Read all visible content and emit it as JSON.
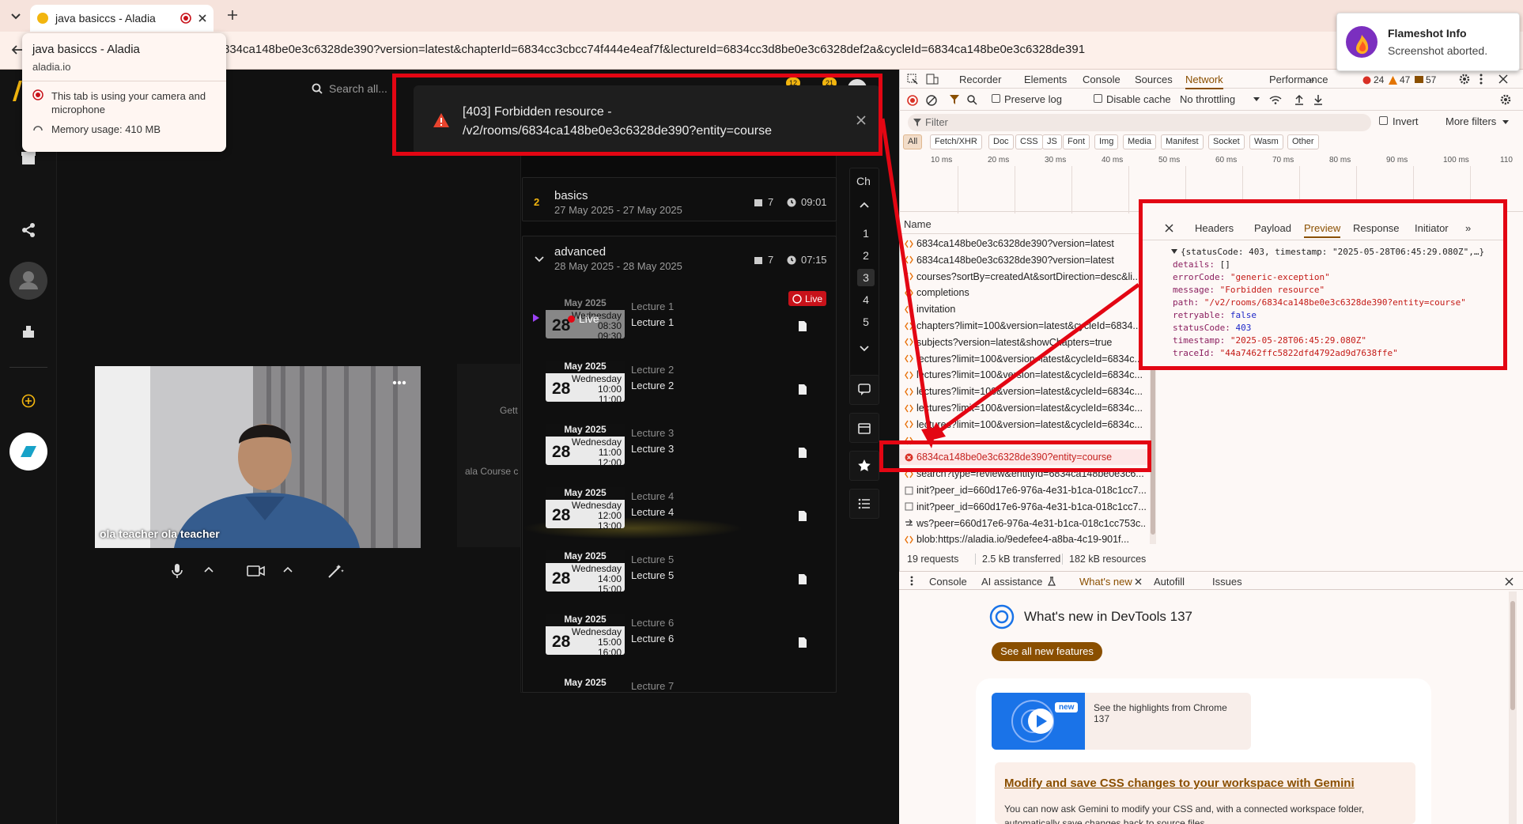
{
  "browser": {
    "tab_title": "java basiccs - Aladia",
    "url": "834ca148be0e3c6328de390?version=latest&chapterId=6834cc3cbcc74f444e4eaf7f&lectureId=6834cc3d8be0e3c6328def2a&cycleId=6834ca148be0e3c6328de391",
    "tab_popup": {
      "title": "java basiccs - Aladia",
      "domain": "aladia.io",
      "camera_note": "This tab is using your camera and microphone",
      "memory": "Memory usage: 410 MB"
    }
  },
  "flameshot": {
    "title": "Flameshot Info",
    "message": "Screenshot aborted."
  },
  "app": {
    "search_placeholder": "Search all...",
    "toast": {
      "line1": "[403] Forbidden resource -",
      "line2": "/v2/rooms/6834ca148be0e3c6328de390?entity=course"
    },
    "ch_label": "Ch",
    "chapters": [
      {
        "number": "2",
        "name": "basics",
        "dates": "27 May 2025 - 27 May 2025",
        "count": "7",
        "time": "09:01"
      },
      {
        "number": "",
        "name": "advanced",
        "dates": "28 May 2025 - 28 May 2025",
        "count": "7",
        "time": "07:15"
      }
    ],
    "live_badge": "Live",
    "live_overlay": "Live",
    "lectures": [
      {
        "month": "May 2025",
        "day": "28",
        "weekday": "Wednesday",
        "start": "08:30",
        "end": "09:30",
        "label": "Lecture 1",
        "name": "Lecture 1"
      },
      {
        "month": "May 2025",
        "day": "28",
        "weekday": "Wednesday",
        "start": "10:00",
        "end": "11:00",
        "label": "Lecture 2",
        "name": "Lecture 2"
      },
      {
        "month": "May 2025",
        "day": "28",
        "weekday": "Wednesday",
        "start": "11:00",
        "end": "12:00",
        "label": "Lecture 3",
        "name": "Lecture 3"
      },
      {
        "month": "May 2025",
        "day": "28",
        "weekday": "Wednesday",
        "start": "12:00",
        "end": "13:00",
        "label": "Lecture 4",
        "name": "Lecture 4"
      },
      {
        "month": "May 2025",
        "day": "28",
        "weekday": "Wednesday",
        "start": "14:00",
        "end": "15:00",
        "label": "Lecture 5",
        "name": "Lecture 5"
      },
      {
        "month": "May 2025",
        "day": "28",
        "weekday": "Wednesday",
        "start": "15:00",
        "end": "16:00",
        "label": "Lecture 6",
        "name": "Lecture 6"
      },
      {
        "month": "May 2025",
        "day": "",
        "weekday": "",
        "start": "",
        "end": "",
        "label": "Lecture 7",
        "name": ""
      }
    ],
    "chapter_numbers": [
      "1",
      "2",
      "3",
      "4",
      "5"
    ],
    "video_name": "ola teacher ola teacher",
    "bg_text1": "Gett",
    "bg_text2": "ala Course c",
    "header_badges": [
      "12",
      "21"
    ]
  },
  "devtools": {
    "tabs": [
      "Recorder",
      "Elements",
      "Console",
      "Sources",
      "Network",
      "Performance",
      "»"
    ],
    "active_tab": "Network",
    "errors": "24",
    "warnings": "47",
    "messages": "57",
    "preserve_log": "Preserve log",
    "disable_cache": "Disable cache",
    "throttling": "No throttling",
    "filter_placeholder": "Filter",
    "invert": "Invert",
    "more_filters": "More filters",
    "type_chips": [
      "All",
      "Fetch/XHR",
      "Doc",
      "CSS",
      "JS",
      "Font",
      "Img",
      "Media",
      "Manifest",
      "Socket",
      "Wasm",
      "Other"
    ],
    "timeline_labels": [
      "10 ms",
      "20 ms",
      "30 ms",
      "40 ms",
      "50 ms",
      "60 ms",
      "70 ms",
      "80 ms",
      "90 ms",
      "100 ms",
      "110"
    ],
    "name_header": "Name",
    "requests": [
      "6834ca148be0e3c6328de390?version=latest",
      "6834ca148be0e3c6328de390?version=latest",
      "courses?sortBy=createdAt&sortDirection=desc&li...",
      "completions",
      "invitation",
      "chapters?limit=100&version=latest&cycleId=6834...",
      "subjects?version=latest&showChapters=true",
      "lectures?limit=100&version=latest&cycleId=6834c...",
      "lectures?limit=100&version=latest&cycleId=6834c...",
      "lectures?limit=100&version=latest&cycleId=6834c...",
      "lectures?limit=100&version=latest&cycleId=6834c...",
      "lectures?limit=100&version=latest&cycleId=6834c...",
      "",
      "6834ca148be0e3c6328de390?entity=course",
      "search?type=review&entityId=6834ca148be0e3c6...",
      "init?peer_id=660d17e6-976a-4e31-b1ca-018c1cc7...",
      "init?peer_id=660d17e6-976a-4e31-b1ca-018c1cc7...",
      "ws?peer=660d17e6-976a-4e31-b1ca-018c1cc753c...",
      "blob:https://aladia.io/9edefee4-a8ba-4c19-901f..."
    ],
    "summary": {
      "requests": "19 requests",
      "transferred": "2.5 kB transferred",
      "resources": "182 kB resources"
    },
    "detail_tabs": [
      "Headers",
      "Payload",
      "Preview",
      "Response",
      "Initiator",
      "»"
    ],
    "detail_active": "Preview",
    "preview": {
      "summary": "{statusCode: 403, timestamp: \"2025-05-28T06:45:29.080Z\",…}",
      "details": "[]",
      "errorCode": "\"generic-exception\"",
      "message": "\"Forbidden resource\"",
      "path": "\"/v2/rooms/6834ca148be0e3c6328de390?entity=course\"",
      "retryable": "false",
      "statusCode": "403",
      "timestamp": "\"2025-05-28T06:45:29.080Z\"",
      "traceId": "\"44a7462ffc5822dfd4792ad9d7638ffe\""
    },
    "drawer_tabs": [
      "Console",
      "AI assistance",
      "What's new",
      "Autofill",
      "Issues"
    ],
    "whats_new": {
      "title": "What's new in DevTools 137",
      "see_all": "See all new features",
      "highlight": "See the highlights from Chrome 137",
      "new_badge": "new",
      "article_title": "Modify and save CSS changes to your workspace with Gemini",
      "article_text": "You can now ask Gemini to modify your CSS and, with a connected workspace folder, automatically save changes back to source files."
    }
  },
  "colors": {
    "highlight_red": "#e30613",
    "accent_orange": "#f2b50f",
    "live_red": "#c8121a"
  }
}
